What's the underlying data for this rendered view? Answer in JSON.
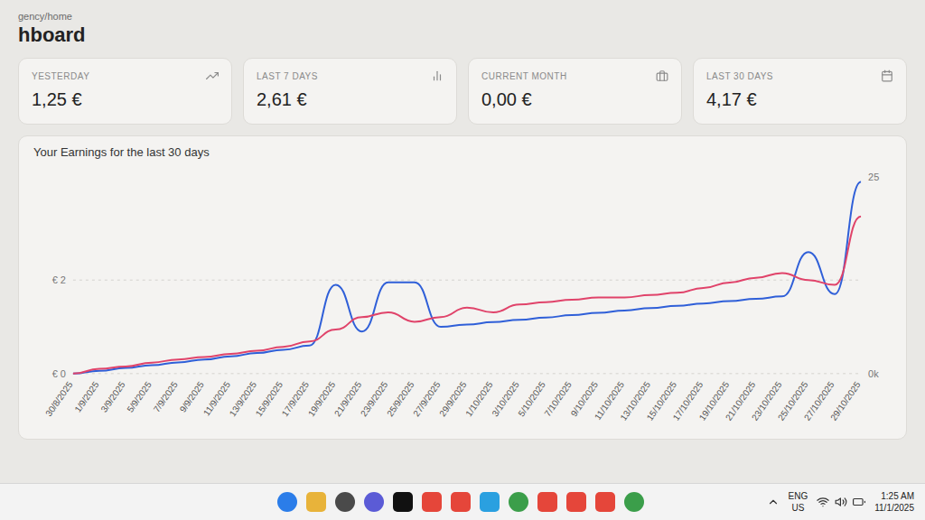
{
  "breadcrumb": "gency/home",
  "title": "hboard",
  "stats": [
    {
      "label": "YESTERDAY",
      "value": "1,25 €"
    },
    {
      "label": "LAST 7 DAYS",
      "value": "2,61 €"
    },
    {
      "label": "CURRENT MONTH",
      "value": "0,00 €"
    },
    {
      "label": "LAST 30 DAYS",
      "value": "4,17 €"
    }
  ],
  "chart": {
    "title": "Your Earnings for the last 30 days",
    "y_ticks": [
      {
        "label": "€ 0",
        "value": 0
      },
      {
        "label": "€ 2",
        "value": 2
      }
    ],
    "y2_ticks": [
      {
        "label": "0k",
        "value": 0
      },
      {
        "label": "25",
        "value": 25
      }
    ],
    "x_labels": [
      "30/8/2025",
      "1/9/2025",
      "3/9/2025",
      "5/9/2025",
      "7/9/2025",
      "9/9/2025",
      "11/9/2025",
      "13/9/2025",
      "15/9/2025",
      "17/9/2025",
      "19/9/2025",
      "21/9/2025",
      "23/9/2025",
      "25/9/2025",
      "27/9/2025",
      "29/9/2025",
      "1/10/2025",
      "3/10/2025",
      "5/10/2025",
      "7/10/2025",
      "9/10/2025",
      "11/10/2025",
      "13/10/2025",
      "15/10/2025",
      "17/10/2025",
      "19/10/2025",
      "21/10/2025",
      "23/10/2025",
      "25/10/2025",
      "27/10/2025",
      "29/10/2025"
    ],
    "series": [
      {
        "color": "#2f5fd8",
        "axis": "left",
        "values": [
          0,
          0.06,
          0.12,
          0.18,
          0.24,
          0.3,
          0.37,
          0.44,
          0.51,
          0.6,
          1.9,
          0.9,
          1.95,
          1.95,
          1.0,
          1.05,
          1.1,
          1.15,
          1.2,
          1.25,
          1.3,
          1.35,
          1.4,
          1.45,
          1.5,
          1.55,
          1.6,
          1.65,
          2.6,
          1.7,
          4.1
        ]
      },
      {
        "color": "#e0436a",
        "axis": "right",
        "values": [
          0,
          0.6,
          0.9,
          1.4,
          1.8,
          2.1,
          2.5,
          2.9,
          3.4,
          4.1,
          5.6,
          7.2,
          7.8,
          6.6,
          7.2,
          8.4,
          7.8,
          8.8,
          9.1,
          9.4,
          9.7,
          9.7,
          10,
          10.3,
          10.9,
          11.6,
          12.2,
          12.8,
          11.9,
          11.3,
          20
        ]
      }
    ]
  },
  "taskbar": {
    "language": "ENG",
    "region": "US",
    "time": "1:25 AM",
    "date": "11/1/2025"
  }
}
